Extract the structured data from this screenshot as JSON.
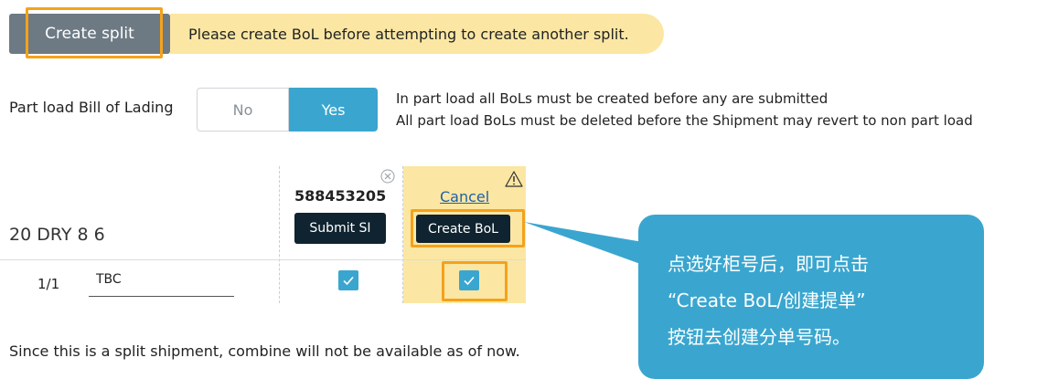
{
  "toolbar": {
    "create_split_label": "Create split",
    "warning_text": "Please create BoL before attempting to create another split."
  },
  "part_load": {
    "label": "Part load Bill of Lading",
    "option_no": "No",
    "option_yes": "Yes",
    "selected": "Yes",
    "info_line_1": "In part load all BoLs must be created before any are submitted",
    "info_line_2": "All part load BoLs must be deleted before the Shipment may revert to non part load"
  },
  "table": {
    "container_label": "20 DRY 8 6",
    "columns": [
      {
        "shipment_number": "588453205",
        "action_label": "Submit SI"
      },
      {
        "cancel_label": "Cancel",
        "action_label": "Create BoL"
      }
    ],
    "rows": [
      {
        "index": "1/1",
        "value": "TBC"
      }
    ]
  },
  "footer_note": "Since this is a split shipment, combine will not be available as of now.",
  "callout": {
    "line_1": "点选好柜号后，即可点击",
    "line_2": "“Create BoL/创建提单”",
    "line_3": "按钮去创建分单号码。"
  },
  "colors": {
    "accent_blue": "#3aa6cf",
    "highlight_orange": "#f5a21b",
    "warning_yellow": "#fbe7a3",
    "dark_button": "#0f2330",
    "grey_button": "#6d7a84"
  }
}
